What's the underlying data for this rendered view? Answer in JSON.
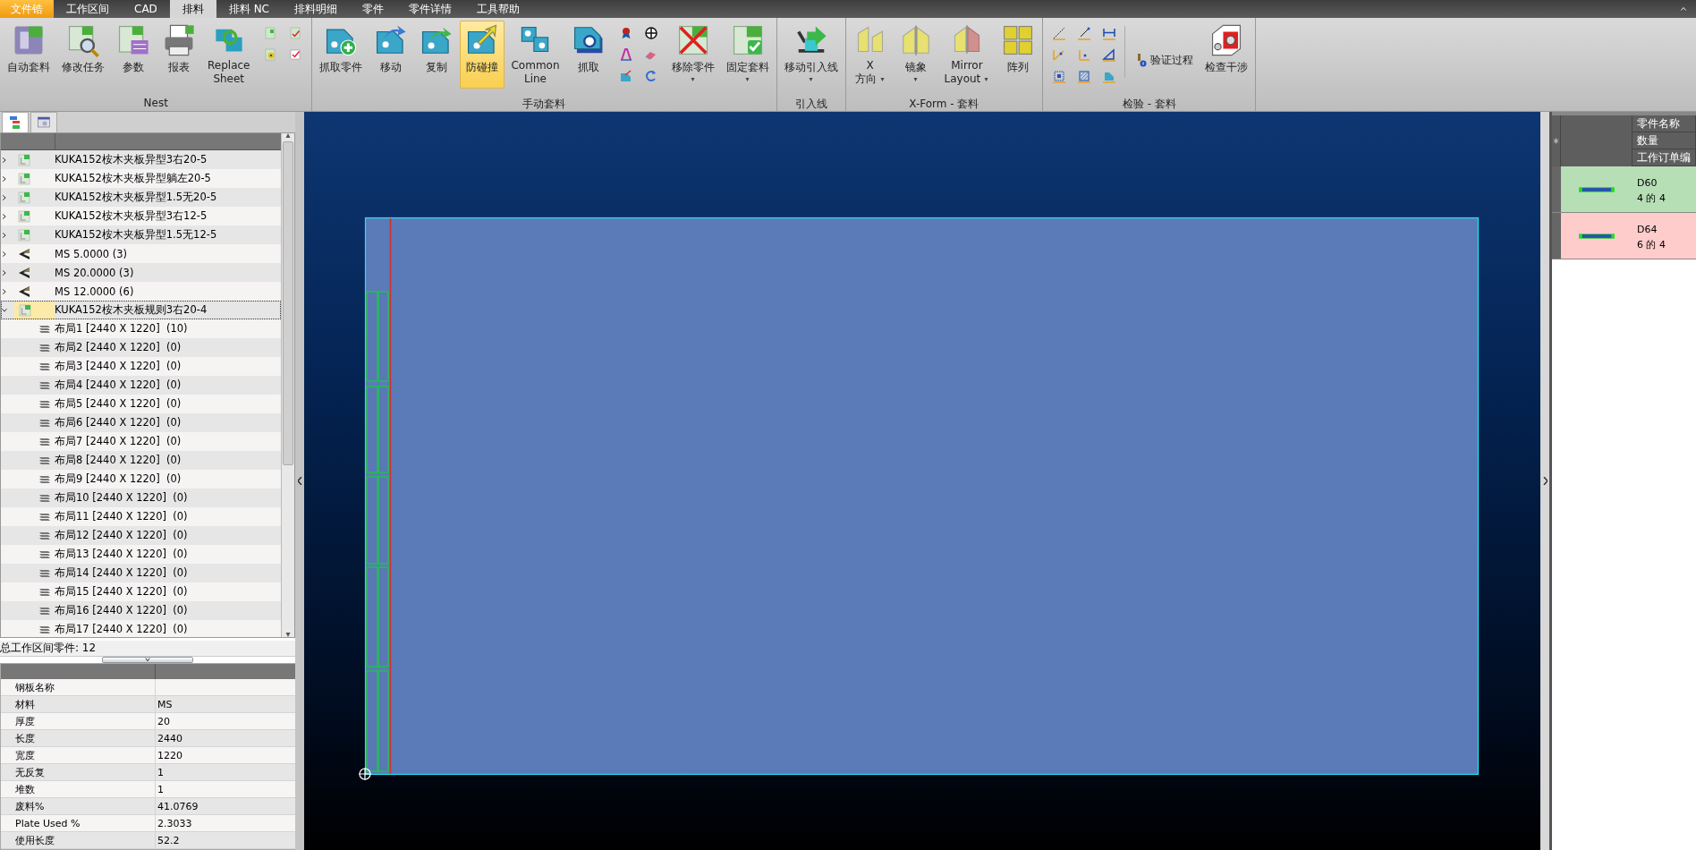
{
  "menu_tabs": [
    {
      "label": "文件锆",
      "kind": "file",
      "selected": false
    },
    {
      "label": "工作区间",
      "kind": "tab",
      "selected": false
    },
    {
      "label": "CAD",
      "kind": "tab",
      "selected": false
    },
    {
      "label": "排料",
      "kind": "tab",
      "selected": true
    },
    {
      "label": "排料 NC",
      "kind": "tab",
      "selected": false
    },
    {
      "label": "排料明细",
      "kind": "tab",
      "selected": false
    },
    {
      "label": "零件",
      "kind": "tab",
      "selected": false
    },
    {
      "label": "零件详情",
      "kind": "tab",
      "selected": false
    },
    {
      "label": "工具帮助",
      "kind": "tab",
      "selected": false
    }
  ],
  "ribbon": {
    "groups": [
      {
        "title": "Nest",
        "items": [
          {
            "kind": "large",
            "label": "自动套料",
            "selected": false,
            "dropdown": false
          },
          {
            "kind": "large",
            "label": "修改任务",
            "selected": false,
            "dropdown": false
          },
          {
            "kind": "large",
            "label": "参数",
            "selected": false,
            "dropdown": false
          },
          {
            "kind": "large",
            "label": "报表",
            "selected": false,
            "dropdown": false
          },
          {
            "kind": "large",
            "label": "Replace\nSheet",
            "selected": false,
            "dropdown": false
          },
          {
            "kind": "small_grid"
          }
        ]
      },
      {
        "title": "手动套料",
        "items": [
          {
            "kind": "large",
            "label": "抓取零件",
            "selected": false,
            "dropdown": false
          },
          {
            "kind": "large",
            "label": "移动",
            "selected": false,
            "dropdown": false
          },
          {
            "kind": "large",
            "label": "复制",
            "selected": false,
            "dropdown": false
          },
          {
            "kind": "large",
            "label": "防碰撞",
            "selected": true,
            "dropdown": false
          },
          {
            "kind": "large",
            "label": "Common\nLine",
            "selected": false,
            "dropdown": false
          },
          {
            "kind": "large",
            "label": "抓取",
            "selected": false,
            "dropdown": false
          },
          {
            "kind": "small_grid"
          },
          {
            "kind": "large",
            "label": "移除零件",
            "selected": false,
            "dropdown": true
          },
          {
            "kind": "large",
            "label": "固定套料",
            "selected": false,
            "dropdown": true
          }
        ]
      },
      {
        "title": "引入线",
        "items": [
          {
            "kind": "large",
            "label": "移动引入线",
            "selected": false,
            "dropdown": true
          }
        ]
      },
      {
        "title": "X-Form - 套料",
        "items": [
          {
            "kind": "large",
            "label": "X\n方向",
            "selected": false,
            "dropdown": true
          },
          {
            "kind": "large",
            "label": "镜象",
            "selected": false,
            "dropdown": true
          },
          {
            "kind": "large",
            "label": "Mirror\nLayout",
            "selected": false,
            "dropdown": true
          },
          {
            "kind": "large",
            "label": "阵列",
            "selected": false,
            "dropdown": false
          }
        ]
      },
      {
        "title": "检验 - 套料",
        "items": [
          {
            "kind": "small_grid"
          },
          {
            "kind": "small",
            "label": "验证过程"
          },
          {
            "kind": "large",
            "label": "检查干涉",
            "selected": false,
            "dropdown": false
          }
        ]
      }
    ]
  },
  "tree": {
    "panel_tabs": [
      {
        "selected": true
      },
      {
        "selected": false
      }
    ],
    "items": [
      {
        "kind": "part",
        "label": "KUKA152桉木夹板异型3右20-5",
        "expanded": false,
        "selected": false
      },
      {
        "kind": "part",
        "label": "KUKA152桉木夹板异型躺左20-5",
        "expanded": false,
        "selected": false
      },
      {
        "kind": "part",
        "label": "KUKA152桉木夹板异型1.5无20-5",
        "expanded": false,
        "selected": false
      },
      {
        "kind": "part",
        "label": "KUKA152桉木夹板异型3右12-5",
        "expanded": false,
        "selected": false
      },
      {
        "kind": "part",
        "label": "KUKA152桉木夹板异型1.5无12-5",
        "expanded": false,
        "selected": false
      },
      {
        "kind": "material",
        "label": "MS 5.0000 (3)",
        "expanded": false,
        "selected": false
      },
      {
        "kind": "material",
        "label": "MS 20.0000 (3)",
        "expanded": false,
        "selected": false
      },
      {
        "kind": "material",
        "label": "MS 12.0000 (6)",
        "expanded": false,
        "selected": false
      },
      {
        "kind": "part",
        "label": "KUKA152桉木夹板规则3右20-4",
        "expanded": true,
        "selected": true,
        "children": [
          {
            "kind": "layout",
            "label": "布局1 [2440 X 1220]  (10)",
            "selected": false
          },
          {
            "kind": "layout",
            "label": "布局2 [2440 X 1220]  (0)",
            "selected": false
          },
          {
            "kind": "layout",
            "label": "布局3 [2440 X 1220]  (0)",
            "selected": false
          },
          {
            "kind": "layout",
            "label": "布局4 [2440 X 1220]  (0)",
            "selected": false
          },
          {
            "kind": "layout",
            "label": "布局5 [2440 X 1220]  (0)",
            "selected": false
          },
          {
            "kind": "layout",
            "label": "布局6 [2440 X 1220]  (0)",
            "selected": false
          },
          {
            "kind": "layout",
            "label": "布局7 [2440 X 1220]  (0)",
            "selected": false
          },
          {
            "kind": "layout",
            "label": "布局8 [2440 X 1220]  (0)",
            "selected": false
          },
          {
            "kind": "layout",
            "label": "布局9 [2440 X 1220]  (0)",
            "selected": false
          },
          {
            "kind": "layout",
            "label": "布局10 [2440 X 1220]  (0)",
            "selected": false
          },
          {
            "kind": "layout",
            "label": "布局11 [2440 X 1220]  (0)",
            "selected": false
          },
          {
            "kind": "layout",
            "label": "布局12 [2440 X 1220]  (0)",
            "selected": false
          },
          {
            "kind": "layout",
            "label": "布局13 [2440 X 1220]  (0)",
            "selected": false
          },
          {
            "kind": "layout",
            "label": "布局14 [2440 X 1220]  (0)",
            "selected": false
          },
          {
            "kind": "layout",
            "label": "布局15 [2440 X 1220]  (0)",
            "selected": false
          },
          {
            "kind": "layout",
            "label": "布局16 [2440 X 1220]  (0)",
            "selected": false
          },
          {
            "kind": "layout",
            "label": "布局17 [2440 X 1220]  (0)",
            "selected": false
          }
        ]
      }
    ]
  },
  "status": "总工作区间零件: 12",
  "properties": [
    {
      "label": "钢板名称"
    },
    {
      "label": "材料",
      "value": "MS"
    },
    {
      "label": "厚度",
      "value": "20"
    },
    {
      "label": "长度",
      "value": "2440"
    },
    {
      "label": "宽度",
      "value": "1220"
    },
    {
      "label": "无反复",
      "value": "1"
    },
    {
      "label": "堆数",
      "value": "1"
    },
    {
      "label": "废料%",
      "value": "41.0769"
    },
    {
      "label": "Plate Used %",
      "value": "2.3033"
    },
    {
      "label": "使用长度",
      "value": "52.2"
    }
  ],
  "part_list": {
    "columns": [
      "零件名称",
      "数量",
      "工作订单编"
    ],
    "rows": [
      {
        "name": "D60",
        "quantity": "4 的 4",
        "color": "#b7dfb6"
      },
      {
        "name": "D64",
        "quantity": "6 的 4",
        "color": "#ffcccc"
      }
    ]
  }
}
